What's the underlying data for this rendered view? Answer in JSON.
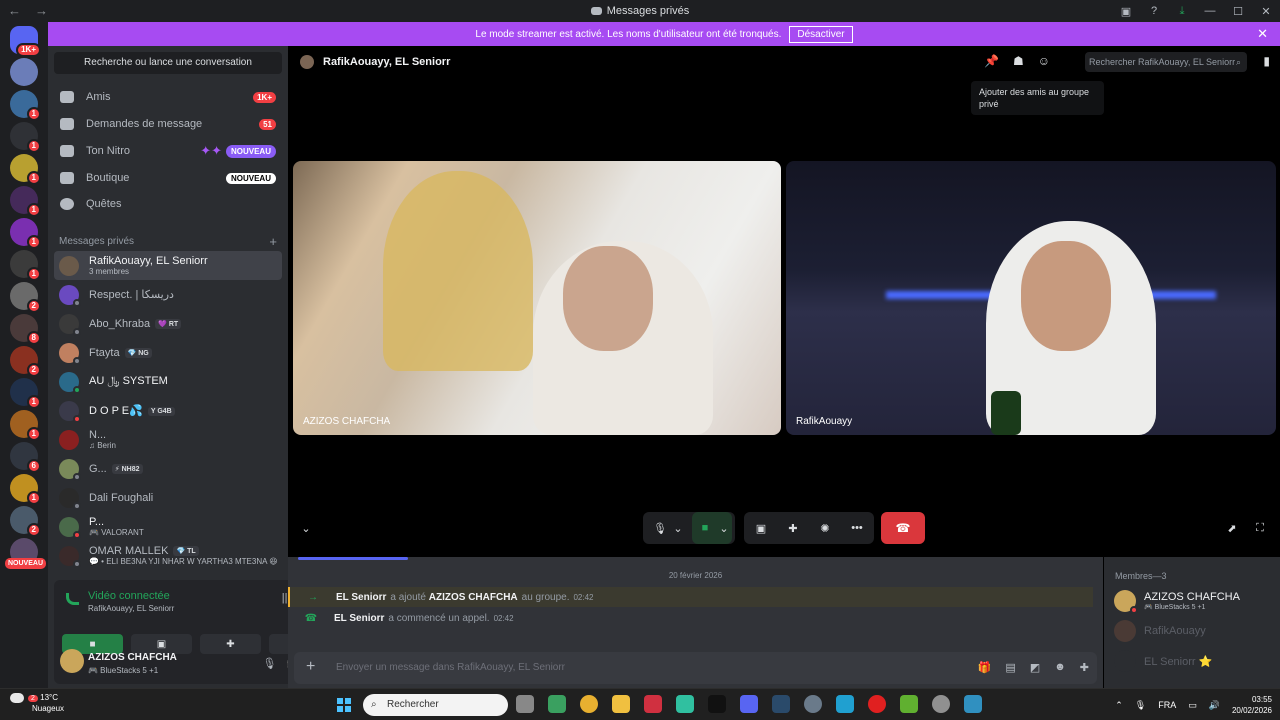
{
  "titlebar": {
    "title": "Messages privés",
    "back": "←",
    "forward": "→"
  },
  "banner": {
    "text": "Le mode streamer est activé. Les noms d'utilisateur ont été tronqués.",
    "button": "Désactiver",
    "close": "✕"
  },
  "servers": {
    "home_badge": "1K+",
    "new_label": "NOUVEAU"
  },
  "sidebar": {
    "search_label": "Recherche ou lance une conversation",
    "nav": [
      {
        "label": "Amis",
        "badge": "1K+"
      },
      {
        "label": "Demandes de message",
        "badge": "51"
      },
      {
        "label": "Ton Nitro",
        "badge": "NOUVEAU"
      },
      {
        "label": "Boutique",
        "badge": "NOUVEAU"
      },
      {
        "label": "Quêtes",
        "badge": ""
      }
    ],
    "dm_header": "Messages privés",
    "dm_add": "+",
    "dms": [
      {
        "name": "RafikAouayy, EL Seniorr",
        "sub": "3 membres",
        "tag": ""
      },
      {
        "name": "Respect. | دريسكا",
        "sub": "",
        "tag": ""
      },
      {
        "name": "Abo_Khraba",
        "sub": "",
        "tag": "💜 RT"
      },
      {
        "name": "Ftayta",
        "sub": "",
        "tag": "💎 NG"
      },
      {
        "name": "AU ﷼ SYSTEM",
        "sub": "",
        "tag": ""
      },
      {
        "name": "D O P E💦",
        "sub": "",
        "tag": "Y G4B"
      },
      {
        "name": "N...",
        "sub": "♫ Berin",
        "tag": ""
      },
      {
        "name": "G...",
        "sub": "",
        "tag": "⚡ NH82"
      },
      {
        "name": "Dali Foughali",
        "sub": "",
        "tag": ""
      },
      {
        "name": "P...",
        "sub": "🎮 VALORANT",
        "tag": ""
      },
      {
        "name": "OMAR MALLEK",
        "sub": "💬 • ELI BE3NA YJI NHAR W YARTHA3 MTE3NA 😆",
        "tag": "💎 TL"
      }
    ]
  },
  "voice": {
    "status": "Vidéo connectée",
    "channel": "RafikAouayy, EL Seniorr"
  },
  "user": {
    "name": "AZIZOS CHAFCHA",
    "status": "🎮 BlueStacks 5 +1"
  },
  "header": {
    "title": "RafikAouayy, EL Seniorr",
    "search_placeholder": "Rechercher RafikAouayy, EL Seniorr",
    "tooltip": "Ajouter des amis au groupe privé"
  },
  "tiles": [
    {
      "label": "AZIZOS CHAFCHA"
    },
    {
      "label": "RafikAouayy"
    }
  ],
  "chat": {
    "date": "20 février 2026",
    "messages": [
      {
        "author": "EL Seniorr",
        "text": "a ajouté",
        "target": "AZIZOS CHAFCHA",
        "rest": "au groupe.",
        "time": "02:42"
      },
      {
        "author": "EL Seniorr",
        "text": "a commencé un appel.",
        "target": "",
        "rest": "",
        "time": "02:42"
      }
    ],
    "composer_placeholder": "Envoyer un message dans RafikAouayy, EL Seniorr"
  },
  "members": {
    "header": "Membres—3",
    "list": [
      {
        "name": "AZIZOS CHAFCHA",
        "sub": "🎮 BlueStacks 5 +1"
      },
      {
        "name": "RafikAouayy",
        "sub": ""
      },
      {
        "name": "EL Seniorr ⭐",
        "sub": ""
      }
    ]
  },
  "taskbar": {
    "temp": "13°C",
    "weather": "Nuageux",
    "weather_badge": "2",
    "search": "Rechercher",
    "lang": "FRA",
    "time": "03:55",
    "date": "20/02/2026"
  },
  "colors": {
    "accent": "#5865f2",
    "banner": "#a74bf2",
    "danger": "#da373c",
    "online": "#23a55a"
  }
}
